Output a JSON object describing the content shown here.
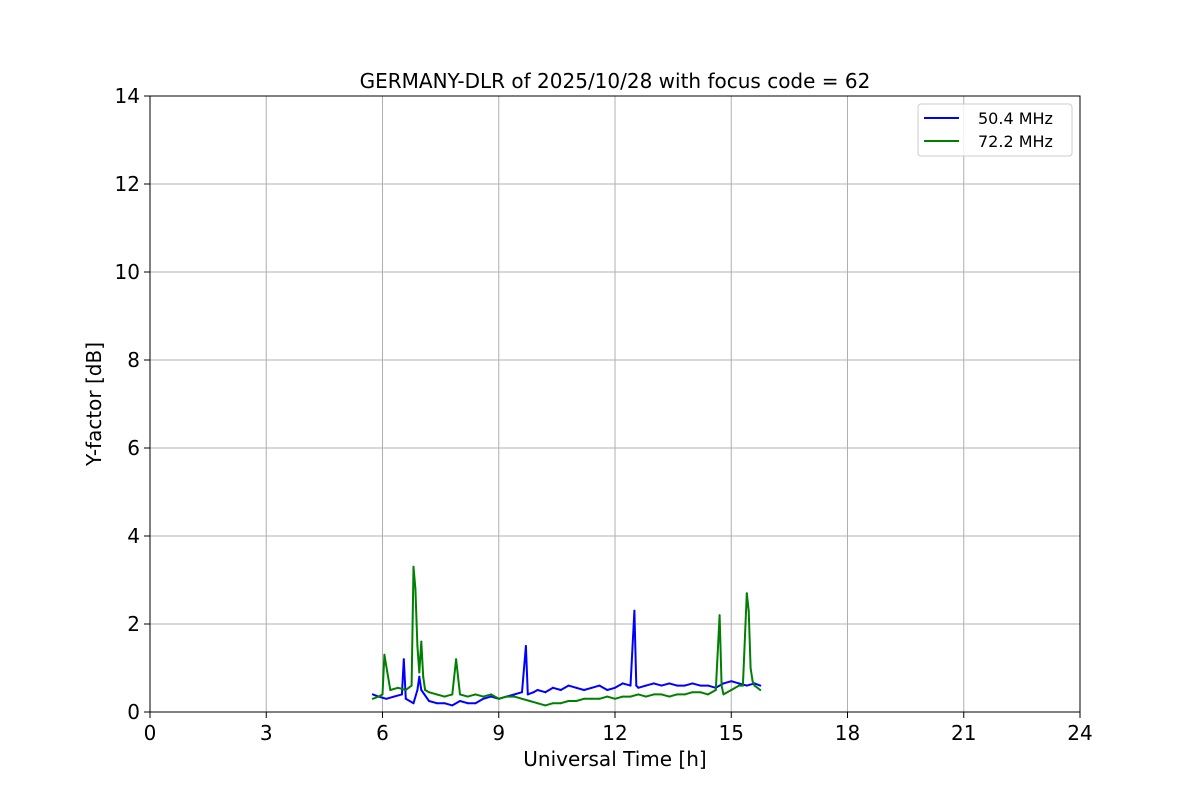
{
  "chart_data": {
    "type": "line",
    "title": "GERMANY-DLR of 2025/10/28 with focus code = 62",
    "xlabel": "Universal Time [h]",
    "ylabel": "Y-factor [dB]",
    "xlim": [
      0,
      24
    ],
    "ylim": [
      0,
      14
    ],
    "xticks": [
      0,
      3,
      6,
      9,
      12,
      15,
      18,
      21,
      24
    ],
    "yticks": [
      0,
      2,
      4,
      6,
      8,
      10,
      12,
      14
    ],
    "grid": true,
    "legend_position": "top-right",
    "series": [
      {
        "name": "50.4 MHz",
        "color": "#0000ff",
        "x": [
          5.75,
          5.9,
          6.1,
          6.3,
          6.5,
          6.55,
          6.6,
          6.8,
          6.9,
          6.95,
          7.0,
          7.2,
          7.4,
          7.6,
          7.8,
          8.0,
          8.2,
          8.4,
          8.6,
          8.8,
          9.0,
          9.2,
          9.4,
          9.6,
          9.7,
          9.75,
          9.9,
          10.0,
          10.2,
          10.4,
          10.6,
          10.8,
          11.0,
          11.2,
          11.4,
          11.6,
          11.8,
          12.0,
          12.2,
          12.4,
          12.5,
          12.55,
          12.6,
          12.8,
          13.0,
          13.2,
          13.4,
          13.6,
          13.8,
          14.0,
          14.2,
          14.4,
          14.6,
          14.8,
          15.0,
          15.2,
          15.4,
          15.6,
          15.75
        ],
        "y": [
          0.4,
          0.35,
          0.3,
          0.35,
          0.4,
          1.2,
          0.3,
          0.2,
          0.5,
          0.8,
          0.5,
          0.25,
          0.2,
          0.2,
          0.15,
          0.25,
          0.2,
          0.2,
          0.3,
          0.35,
          0.3,
          0.35,
          0.4,
          0.45,
          1.5,
          0.4,
          0.45,
          0.5,
          0.45,
          0.55,
          0.5,
          0.6,
          0.55,
          0.5,
          0.55,
          0.6,
          0.5,
          0.55,
          0.65,
          0.6,
          2.3,
          0.6,
          0.55,
          0.6,
          0.65,
          0.6,
          0.65,
          0.6,
          0.6,
          0.65,
          0.6,
          0.6,
          0.55,
          0.65,
          0.7,
          0.65,
          0.6,
          0.65,
          0.6
        ]
      },
      {
        "name": "72.2 MHz",
        "color": "#008000",
        "x": [
          5.75,
          5.9,
          6.0,
          6.05,
          6.2,
          6.4,
          6.6,
          6.75,
          6.8,
          6.85,
          6.9,
          6.95,
          7.0,
          7.05,
          7.1,
          7.2,
          7.4,
          7.6,
          7.8,
          7.9,
          8.0,
          8.2,
          8.4,
          8.6,
          8.8,
          9.0,
          9.2,
          9.4,
          9.6,
          9.8,
          10.0,
          10.2,
          10.4,
          10.6,
          10.8,
          11.0,
          11.2,
          11.4,
          11.6,
          11.8,
          12.0,
          12.2,
          12.4,
          12.6,
          12.8,
          13.0,
          13.2,
          13.4,
          13.6,
          13.8,
          14.0,
          14.2,
          14.4,
          14.6,
          14.7,
          14.75,
          14.8,
          15.0,
          15.2,
          15.3,
          15.4,
          15.45,
          15.5,
          15.55,
          15.6,
          15.75
        ],
        "y": [
          0.3,
          0.35,
          0.4,
          1.3,
          0.5,
          0.55,
          0.5,
          0.6,
          3.3,
          2.8,
          1.5,
          0.9,
          1.6,
          0.8,
          0.5,
          0.45,
          0.4,
          0.35,
          0.4,
          1.2,
          0.4,
          0.35,
          0.4,
          0.35,
          0.4,
          0.3,
          0.35,
          0.35,
          0.3,
          0.25,
          0.2,
          0.15,
          0.2,
          0.2,
          0.25,
          0.25,
          0.3,
          0.3,
          0.3,
          0.35,
          0.3,
          0.35,
          0.35,
          0.4,
          0.35,
          0.4,
          0.4,
          0.35,
          0.4,
          0.4,
          0.45,
          0.45,
          0.4,
          0.5,
          2.2,
          0.6,
          0.4,
          0.5,
          0.6,
          0.6,
          2.7,
          2.3,
          1.0,
          0.7,
          0.6,
          0.5
        ]
      }
    ]
  }
}
